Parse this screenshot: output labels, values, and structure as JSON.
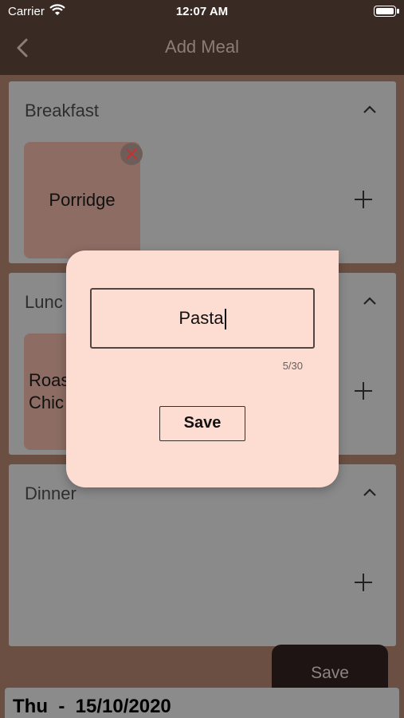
{
  "status_bar": {
    "carrier": "Carrier",
    "time": "12:07 AM"
  },
  "nav": {
    "title": "Add Meal",
    "back_icon": "chevron-left-icon"
  },
  "sections": [
    {
      "title": "Breakfast",
      "items": [
        "Porridge"
      ]
    },
    {
      "title": "Lunch",
      "items": [
        "Roast Chicken"
      ],
      "visible_title": "Lunc",
      "visible_item": [
        "Roas",
        "Chic"
      ]
    },
    {
      "title": "Dinner",
      "items": []
    }
  ],
  "bottom": {
    "save_label": "Save",
    "date": "Thu  -  15/10/2020"
  },
  "dialog": {
    "input_value": "Pasta",
    "counter": "5/30",
    "save_label": "Save"
  },
  "colors": {
    "nav_bg": "#3a2a24",
    "dialog_bg": "#fddcd2",
    "remove_accent": "#c23333"
  }
}
